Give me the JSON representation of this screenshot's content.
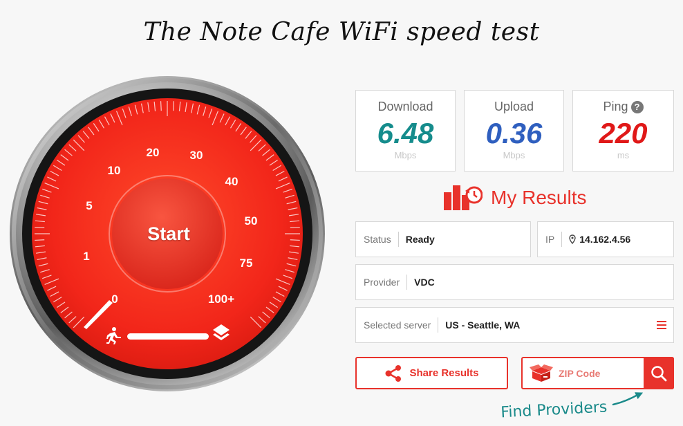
{
  "title": "The Note Cafe WiFi speed test",
  "gauge": {
    "start_label": "Start",
    "scale": [
      "0",
      "1",
      "5",
      "10",
      "20",
      "30",
      "40",
      "50",
      "75",
      "100+"
    ],
    "progress": 0
  },
  "results": {
    "download": {
      "label": "Download",
      "value": "6.48",
      "unit": "Mbps",
      "color": "#158c8c"
    },
    "upload": {
      "label": "Upload",
      "value": "0.36",
      "unit": "Mbps",
      "color": "#2f5fbf"
    },
    "ping": {
      "label": "Ping",
      "value": "220",
      "unit": "ms",
      "color": "#e01818",
      "help": "?"
    }
  },
  "my_results_label": "My Results",
  "status": {
    "label": "Status",
    "value": "Ready"
  },
  "ip": {
    "label": "IP",
    "value": "14.162.4.56"
  },
  "provider": {
    "label": "Provider",
    "value": "VDC"
  },
  "server": {
    "label": "Selected server",
    "value": "US - Seattle, WA"
  },
  "share": {
    "label": "Share Results"
  },
  "zip": {
    "placeholder": "ZIP Code"
  },
  "find_providers": "Find Providers",
  "colors": {
    "accent": "#e8322b",
    "gauge_red": "#f0271a",
    "background": "#f7f7f7"
  }
}
